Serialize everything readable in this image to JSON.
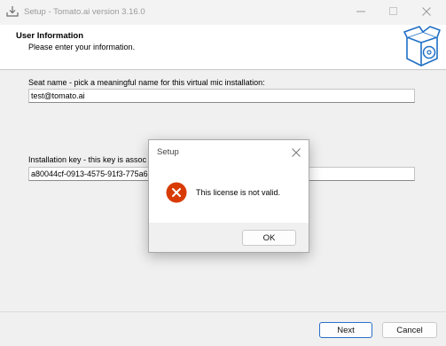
{
  "window": {
    "title": "Setup - Tomato.ai version 3.16.0",
    "app_icon": "installer-icon",
    "controls": [
      "minimize-icon",
      "maximize-icon",
      "close-icon"
    ]
  },
  "header": {
    "title": "User Information",
    "subtitle": "Please enter your information.",
    "icon": "software-box-icon"
  },
  "form": {
    "seat_label": "Seat name - pick a meaningful name for this virtual mic installation:",
    "seat_value": "test@tomato.ai",
    "key_label": "Installation key - this key is assoc",
    "key_value": "a80044cf-0913-4575-91f3-775a6"
  },
  "footer": {
    "next_label": "Next",
    "cancel_label": "Cancel"
  },
  "dialog": {
    "title": "Setup",
    "message": "This license is not valid.",
    "ok_label": "OK",
    "icon": "error-icon",
    "error_color": "#d83b01"
  }
}
